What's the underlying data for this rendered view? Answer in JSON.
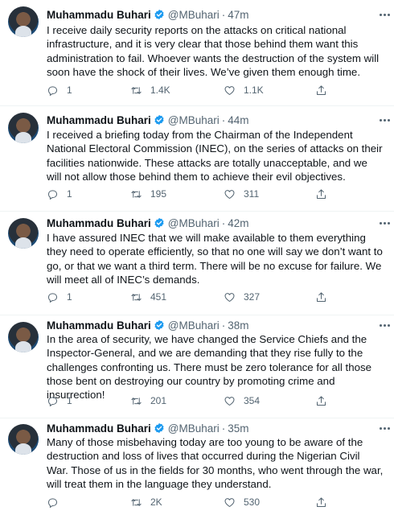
{
  "tweets": [
    {
      "name": "Muhammadu Buhari",
      "handle": "@MBuhari",
      "separator": "·",
      "time": "47m",
      "text": "I receive daily security reports on the attacks on critical national infrastructure, and it is very clear that those behind them want this administration to fail. Whoever wants the destruction of the system will soon have the shock of their lives. We’ve given them enough time.",
      "replies": "1",
      "retweets": "1.4K",
      "likes": "1.1K"
    },
    {
      "name": "Muhammadu Buhari",
      "handle": "@MBuhari",
      "separator": "·",
      "time": "44m",
      "text": "I received a briefing today from the Chairman of the Independent National Electoral Commission (INEC), on the series of attacks on their facilities nationwide. These attacks are totally unacceptable, and we will not allow those behind them to achieve their evil objectives.",
      "replies": "1",
      "retweets": "195",
      "likes": "311"
    },
    {
      "name": "Muhammadu Buhari",
      "handle": "@MBuhari",
      "separator": "·",
      "time": "42m",
      "text": "I have assured INEC that we will make available to them everything they need to operate efficiently, so that no one will say we don’t want to go, or that we want a third term. There will be no excuse for failure. We will meet all of INEC’s demands.",
      "replies": "1",
      "retweets": "451",
      "likes": "327"
    },
    {
      "name": "Muhammadu Buhari",
      "handle": "@MBuhari",
      "separator": "·",
      "time": "38m",
      "text": "In the area of security, we have changed the Service Chiefs and the Inspector-General, and we are demanding that they rise fully to the challenges confronting us. There must be zero tolerance for all those those bent on destroying our country by promoting crime and insurrection!",
      "replies": "1",
      "retweets": "201",
      "likes": "354"
    },
    {
      "name": "Muhammadu Buhari",
      "handle": "@MBuhari",
      "separator": "·",
      "time": "35m",
      "text": "Many of those misbehaving today are too young to be aware of the destruction and loss of lives that occurred during the Nigerian Civil War. Those of us in the fields for 30 months, who went through the war, will treat them in the language they understand.",
      "replies": "",
      "retweets": "2K",
      "likes": "530"
    }
  ]
}
